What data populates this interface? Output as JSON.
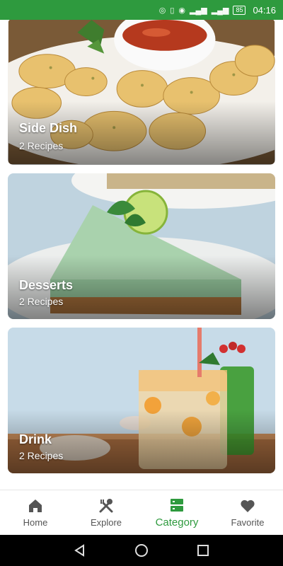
{
  "status_bar": {
    "battery": "85",
    "time": "04:16",
    "icons": [
      "nfc-icon",
      "vibrate-icon",
      "eye-icon",
      "signal-4g-icon",
      "signal-3g-icon"
    ]
  },
  "categories": [
    {
      "title": "Side Dish",
      "count": "2 Recipes"
    },
    {
      "title": "Desserts",
      "count": "2 Recipes"
    },
    {
      "title": "Drink",
      "count": "2 Recipes"
    }
  ],
  "bottom_nav": {
    "items": [
      {
        "label": "Home",
        "icon": "home-icon"
      },
      {
        "label": "Explore",
        "icon": "utensils-icon"
      },
      {
        "label": "Category",
        "icon": "category-list-icon"
      },
      {
        "label": "Favorite",
        "icon": "heart-icon"
      }
    ],
    "active": "Category"
  },
  "colors": {
    "accent": "#2e9a3e",
    "inactive": "#555555"
  }
}
